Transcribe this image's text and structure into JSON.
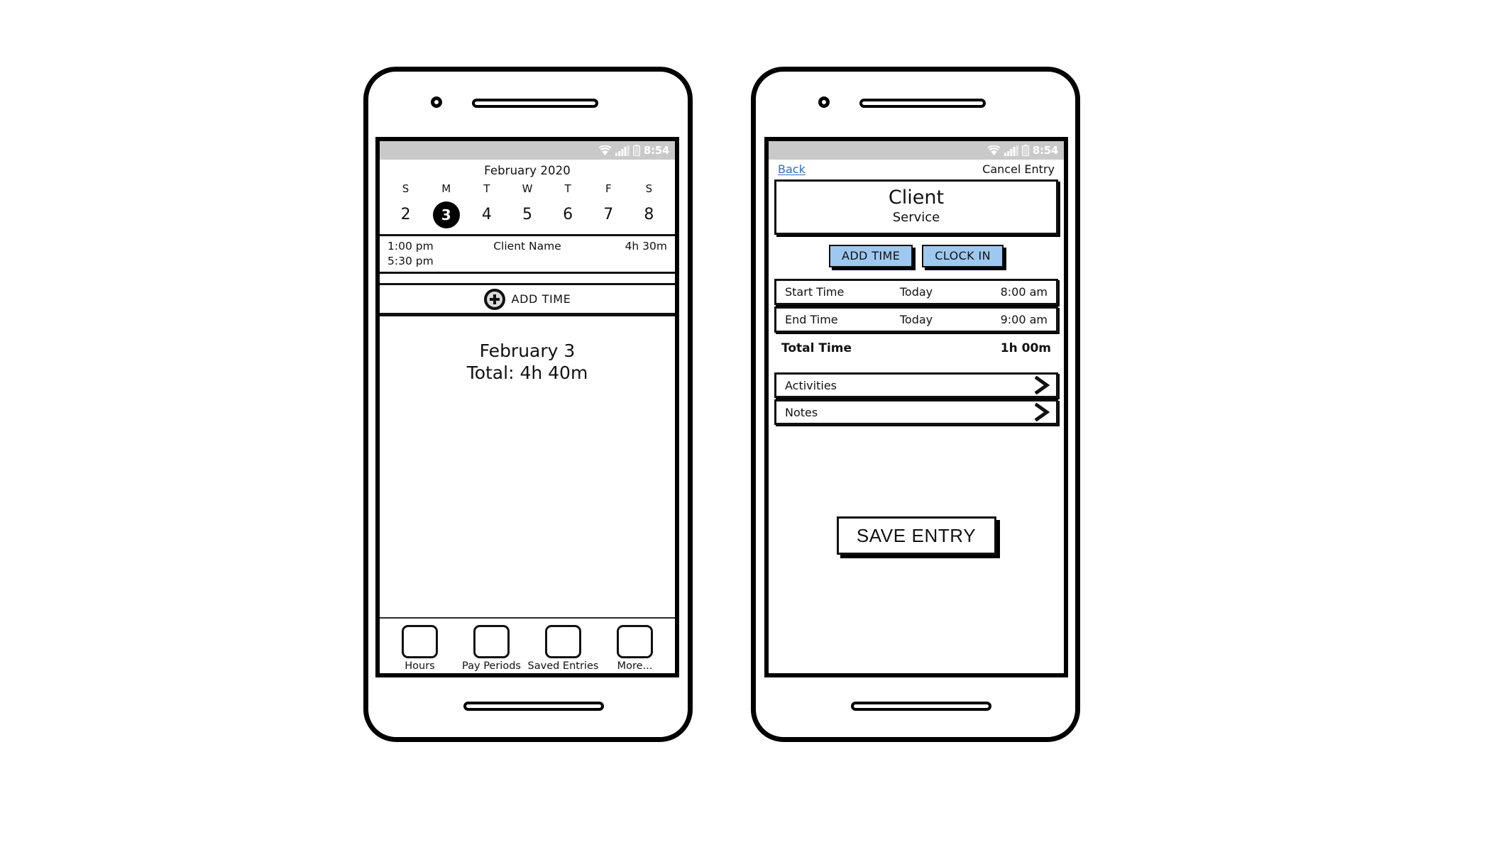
{
  "status_bar": {
    "time": "8:54",
    "icons": [
      "wifi-icon",
      "cellular-signal-icon",
      "battery-icon"
    ]
  },
  "phone_hours": {
    "calendar": {
      "month_label": "February 2020",
      "day_initials": [
        "S",
        "M",
        "T",
        "W",
        "T",
        "F",
        "S"
      ],
      "dates": [
        "2",
        "3",
        "4",
        "5",
        "6",
        "7",
        "8"
      ],
      "selected_index": 1
    },
    "entries": [
      {
        "start_time": "1:00 pm",
        "end_time": "5:30 pm",
        "client": "Client Name",
        "duration": "4h 30m"
      }
    ],
    "add_time": {
      "label": "ADD TIME",
      "icon": "plus-circle-icon"
    },
    "summary": {
      "date": "February 3",
      "total": "Total: 4h 40m"
    },
    "tabs": [
      {
        "label": "Hours"
      },
      {
        "label": "Pay Periods"
      },
      {
        "label": "Saved Entries"
      },
      {
        "label": "More..."
      }
    ]
  },
  "phone_entry": {
    "nav": {
      "back_label": "Back",
      "cancel_label": "Cancel Entry",
      "back_color": "#2f6fc0"
    },
    "client_card": {
      "client": "Client",
      "service": "Service"
    },
    "action_buttons": [
      {
        "label": "ADD TIME"
      },
      {
        "label": "CLOCK IN"
      }
    ],
    "button_color": "#9ec8f0",
    "fields": [
      {
        "label": "Start Time",
        "day": "Today",
        "value": "8:00 am"
      },
      {
        "label": "End Time",
        "day": "Today",
        "value": "9:00 am"
      }
    ],
    "total": {
      "label": "Total Time",
      "value": "1h 00m"
    },
    "links": [
      {
        "label": "Activities",
        "icon": "chevron-right-icon"
      },
      {
        "label": "Notes",
        "icon": "chevron-right-icon"
      }
    ],
    "save": {
      "label": "SAVE ENTRY"
    }
  }
}
